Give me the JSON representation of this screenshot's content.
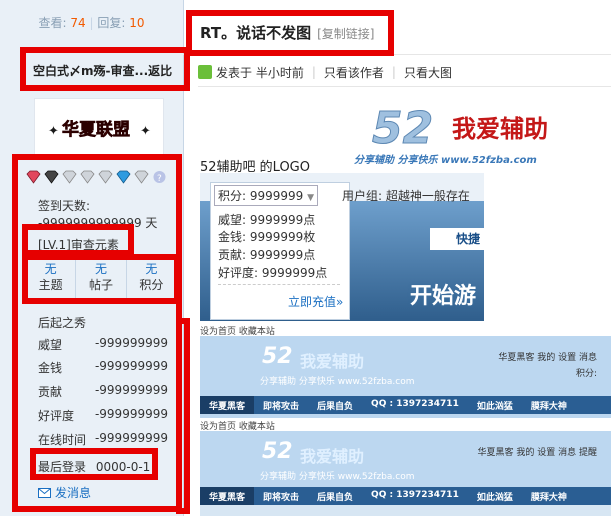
{
  "left": {
    "views_label": "查看:",
    "views": "74",
    "replies_label": "回复:",
    "replies": "10",
    "author": "空白式〆m殇-审查...返比",
    "logo_text": "华夏联盟",
    "sign_days_label": "签到天数:",
    "sign_days_value": "-9999999999999 天",
    "level": "[LV.1]审查元素",
    "stats": [
      {
        "value": "无",
        "label": "主题"
      },
      {
        "value": "无",
        "label": "帖子"
      },
      {
        "value": "无",
        "label": "积分"
      }
    ],
    "rank_title": "后起之秀",
    "profile": [
      {
        "key": "威望",
        "value": "-999999999"
      },
      {
        "key": "金钱",
        "value": "-999999999"
      },
      {
        "key": "贡献",
        "value": "-999999999"
      },
      {
        "key": "好评度",
        "value": "-999999999"
      },
      {
        "key": "在线时间",
        "value": "-999999999"
      }
    ],
    "last_login_label": "最后登录",
    "last_login_value": "0000-0-1",
    "send_message": "发消息"
  },
  "post": {
    "title": "RT。说话不发图",
    "copy_link": "[复制链接]",
    "posted_at": "发表于 半小时前",
    "only_author": "只看该作者",
    "only_big_image": "只看大图",
    "logo_caption": "52辅助吧 的LOGO"
  },
  "banner": {
    "num": "52",
    "name": "我爱辅助",
    "slogan": "分享辅助  分享快乐  www.52fzba.com"
  },
  "shot1": {
    "points_select": "积分: 9999999",
    "usergroup": "用户组: 超越神一般存在",
    "popup_lines": [
      "威望: 9999999点",
      "金钱: 9999999枚",
      "贡献: 9999999点",
      "好评度: 9999999点"
    ],
    "recharge": "立即充值»",
    "fast_button": "快捷",
    "start_text": "开始游"
  },
  "shot2": {
    "topline": "设为首页  收藏本站",
    "brand_num": "52",
    "brand_name": "我爱辅助",
    "site": "分享辅助  分享快乐  www.52fzba.com",
    "right_links": "华夏黑客  我的  设置  消息",
    "points": "积分:",
    "nav": [
      "华夏黑客",
      "即将攻击",
      "后果自负",
      "QQ : 1397234711",
      "如此汹猛",
      "膜拜大神"
    ]
  },
  "shot3": {
    "topline": "设为首页  收藏本站",
    "brand_num": "52",
    "brand_name": "我爱辅助",
    "site": "分享辅助  分享快乐  www.52fzba.com",
    "right_links": "华夏黑客  我的  设置  消息  提醒",
    "nav": [
      "华夏黑客",
      "即将攻击",
      "后果自负",
      "QQ : 1397234711",
      "如此汹猛",
      "膜拜大神"
    ]
  },
  "colors": {
    "highlight": "#e60000",
    "link": "#1a6fc2",
    "accent": "#f25a00",
    "nav": "#2a5e93"
  }
}
